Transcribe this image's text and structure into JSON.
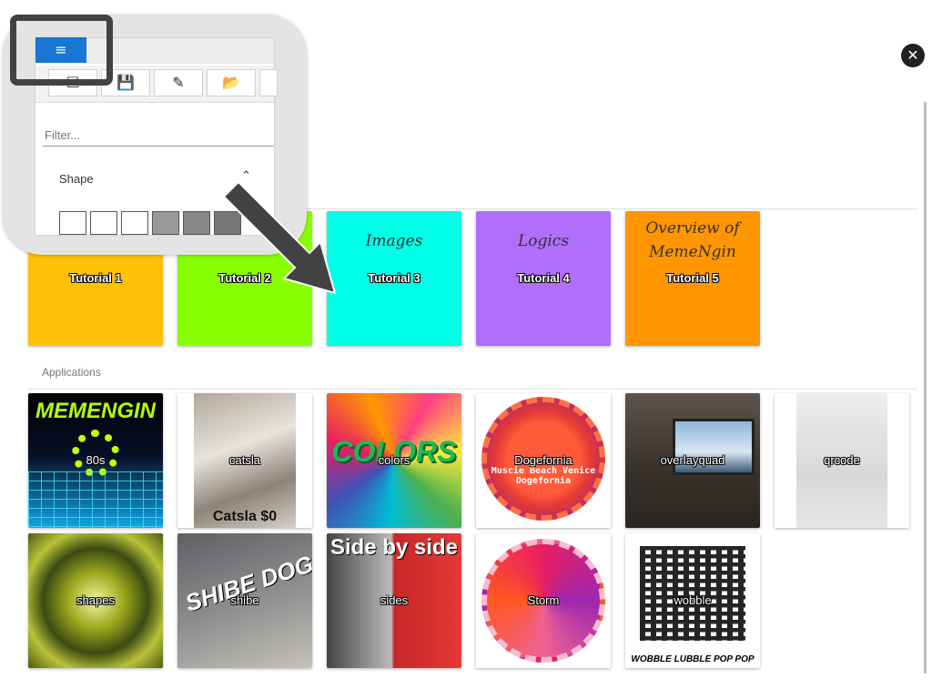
{
  "close": {
    "glyph": "✕"
  },
  "sections": {
    "applications": "Applications"
  },
  "tutorials": [
    {
      "title": "Tutorial 1",
      "caption": "",
      "color": "#ffc107"
    },
    {
      "title": "Tutorial 2",
      "caption": "",
      "color": "#88ff00"
    },
    {
      "title": "Tutorial 3",
      "caption": "Images",
      "color": "#00ffe6"
    },
    {
      "title": "Tutorial 4",
      "caption": "Logics",
      "color": "#b16dfc"
    },
    {
      "title": "Tutorial 5",
      "caption": "Overview of MemeNgin",
      "color": "#ff9600"
    }
  ],
  "applications": [
    {
      "name": "80s",
      "thumb_text": "MEMENGIN"
    },
    {
      "name": "catsla",
      "thumb_text": "Catsla $0"
    },
    {
      "name": "colors",
      "thumb_text": "COLORS"
    },
    {
      "name": "Dogefornia",
      "thumb_text": "Muscie Beach Venice Dogefornia"
    },
    {
      "name": "overlayquad",
      "thumb_text": ""
    },
    {
      "name": "qrcode",
      "thumb_text": ""
    },
    {
      "name": "shapes",
      "thumb_text": ""
    },
    {
      "name": "shibe",
      "thumb_text": "SHIBE DOG"
    },
    {
      "name": "sides",
      "thumb_text": "Side by side"
    },
    {
      "name": "Storm",
      "thumb_text": ""
    },
    {
      "name": "wobble",
      "thumb_text": "WOBBLE LUBBLE POP POP"
    }
  ],
  "callout": {
    "menu_glyph": "≡",
    "filter_placeholder": "Filter...",
    "section": "Shape",
    "chevron": "⌃",
    "toolbar_icons": [
      "☑",
      "💾",
      "✎",
      "📂"
    ]
  }
}
